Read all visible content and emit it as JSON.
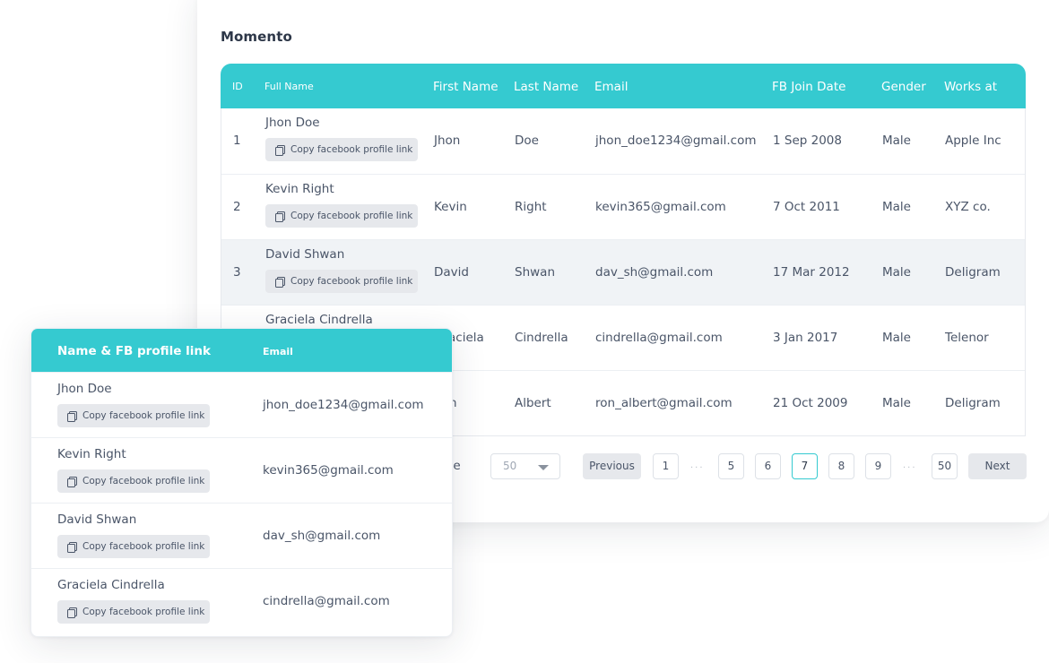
{
  "main": {
    "title": "Momento",
    "columns": [
      "ID",
      "Full Name",
      "First Name",
      "Last Name",
      "Email",
      "FB Join Date",
      "Gender",
      "Works at"
    ],
    "copy_label": "Copy facebook profile link",
    "rows": [
      {
        "id": "1",
        "full_name": "Jhon Doe",
        "first": "Jhon",
        "last": "Doe",
        "email": "jhon_doe1234@gmail.com",
        "join": "1 Sep 2008",
        "gender": "Male",
        "works": "Apple Inc"
      },
      {
        "id": "2",
        "full_name": "Kevin Right",
        "first": "Kevin",
        "last": "Right",
        "email": "kevin365@gmail.com",
        "join": "7 Oct 2011",
        "gender": "Male",
        "works": "XYZ co."
      },
      {
        "id": "3",
        "full_name": "David Shwan",
        "first": "David",
        "last": "Shwan",
        "email": "dav_sh@gmail.com",
        "join": "17 Mar 2012",
        "gender": "Male",
        "works": "Deligram"
      },
      {
        "id": "",
        "full_name": "Graciela Cindrella",
        "first": "Graciela",
        "last": "Cindrella",
        "email": "cindrella@gmail.com",
        "join": "3 Jan 2017",
        "gender": "Male",
        "works": "Telenor"
      },
      {
        "id": "",
        "full_name": "",
        "first": "Ron",
        "last": "Albert",
        "email": "ron_albert@gmail.com",
        "join": "21 Oct 2009",
        "gender": "Male",
        "works": "Deligram"
      }
    ],
    "pager": {
      "label": "ange",
      "page_size": "50",
      "previous": "Previous",
      "next": "Next",
      "pages": [
        "1",
        "5",
        "6",
        "7",
        "8",
        "9",
        "50"
      ],
      "current_page": "7",
      "ellipsis": "..."
    }
  },
  "overlay": {
    "columns": [
      "Name & FB profile link",
      "Email"
    ],
    "copy_label": "Copy facebook profile link",
    "rows": [
      {
        "name": "Jhon Doe",
        "email": "jhon_doe1234@gmail.com"
      },
      {
        "name": "Kevin Right",
        "email": "kevin365@gmail.com"
      },
      {
        "name": "David Shwan",
        "email": "dav_sh@gmail.com"
      },
      {
        "name": "Graciela Cindrella",
        "email": "cindrella@gmail.com"
      }
    ]
  },
  "colors": {
    "accent": "#35cad0",
    "text": "#4a5568",
    "title": "#2d3748",
    "button_gray": "#e6e8ec",
    "row_highlight": "#f0f3f6"
  }
}
